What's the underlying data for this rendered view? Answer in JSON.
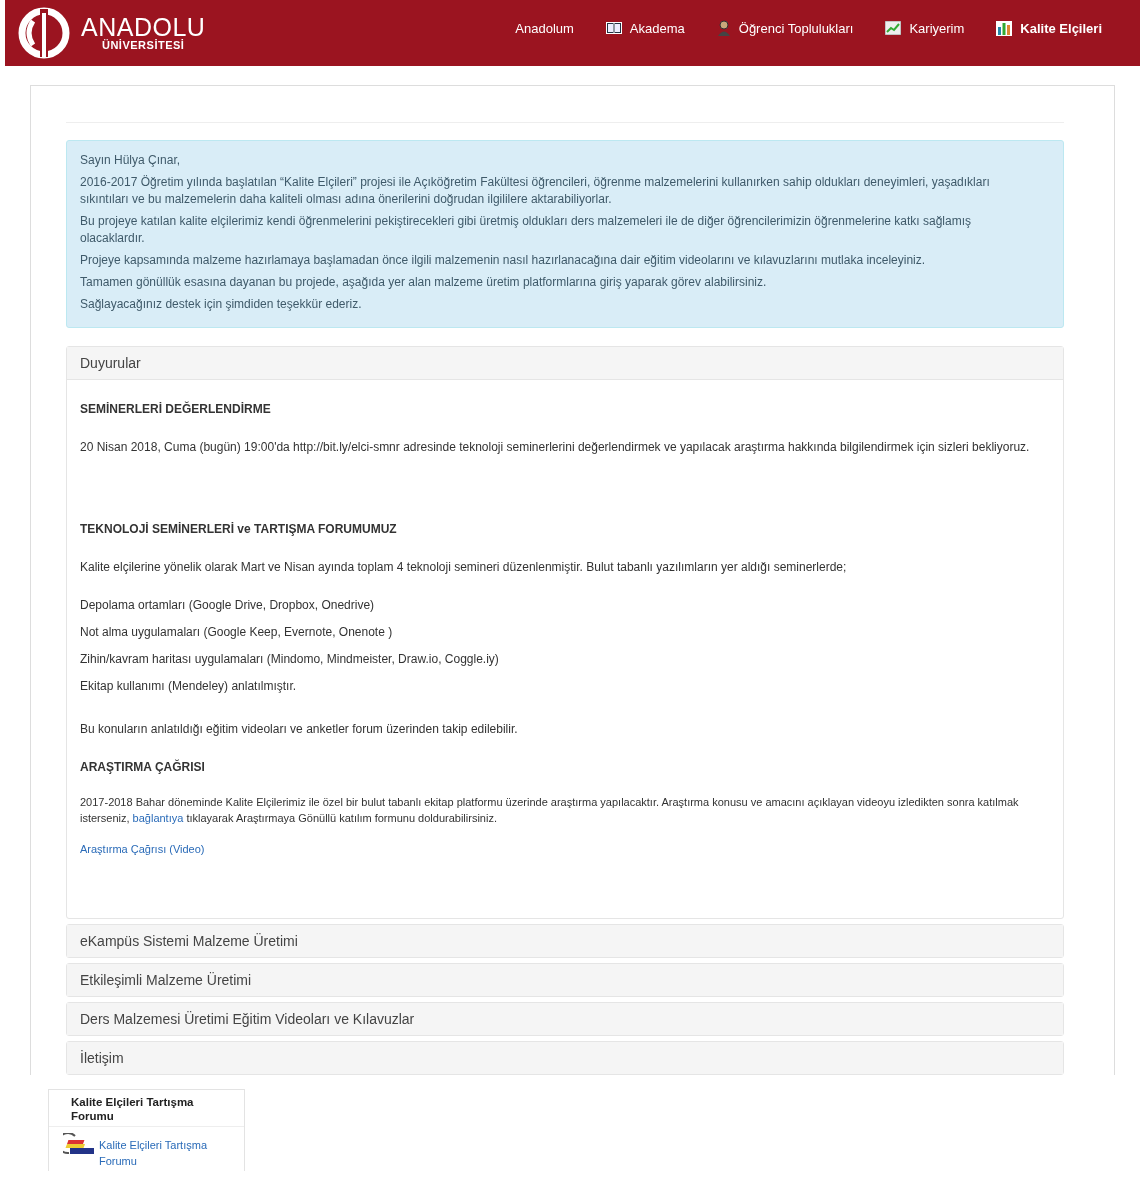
{
  "header": {
    "logo": {
      "name": "ANADOLU",
      "sub": "ÜNİVERSİTESİ"
    },
    "nav": [
      {
        "label": "Anadolum",
        "selected": false
      },
      {
        "label": "Akadema",
        "selected": false
      },
      {
        "label": "Öğrenci Toplulukları",
        "selected": false
      },
      {
        "label": "Kariyerim",
        "selected": false
      },
      {
        "label": "Kalite Elçileri",
        "selected": true
      }
    ]
  },
  "welcome": [
    "Sayın Hülya Çınar,",
    "2016-2017 Öğretim yılında başlatılan “Kalite Elçileri” projesi ile Açıköğretim Fakültesi öğrencileri, öğrenme malzemelerini kullanırken sahip oldukları deneyimleri, yaşadıkları sıkıntıları ve bu malzemelerin daha kaliteli olması adına önerilerini doğrudan ilgililere aktarabiliyorlar.",
    "Bu projeye katılan kalite elçilerimiz kendi öğrenmelerini pekiştirecekleri gibi üretmiş oldukları ders malzemeleri ile de diğer öğrencilerimizin öğrenmelerine katkı sağlamış olacaklardır.",
    "Projeye kapsamında malzeme hazırlamaya başlamadan önce ilgili malzemenin nasıl hazırlanacağına dair eğitim videolarını ve kılavuzlarını mutlaka inceleyiniz.",
    "Tamamen gönüllük esasına dayanan bu projede, aşağıda yer alan malzeme üretim platformlarına giriş yaparak görev alabilirsiniz.",
    "Sağlayacağınız destek için şimdiden teşekkür ederiz."
  ],
  "panels": [
    {
      "title": "Duyurular",
      "expanded": true,
      "blocks": [
        {
          "kind": "heading",
          "text": "SEMİNERLERİ DEĞERLENDİRME"
        },
        {
          "kind": "paragraph",
          "text": "20 Nisan 2018, Cuma (bugün) 19:00'da http://bit.ly/elci-smnr adresinde teknoloji seminerlerini değerlendirmek ve yapılacak araştırma hakkında bilgilendirmek için sizleri bekliyoruz."
        },
        {
          "kind": "heading",
          "text": "TEKNOLOJİ SEMİNERLERİ ve TARTIŞMA FORUMUMUZ"
        },
        {
          "kind": "paragraph",
          "text": "Kalite elçilerine yönelik olarak Mart ve Nisan ayında toplam 4 teknoloji semineri düzenlenmiştir. Bulut tabanlı yazılımların yer aldığı seminerlerde;"
        },
        {
          "kind": "item",
          "text": "Depolama ortamları (Google Drive, Dropbox, Onedrive)"
        },
        {
          "kind": "item",
          "text": "Not alma uygulamaları (Google Keep, Evernote, Onenote )"
        },
        {
          "kind": "item",
          "text": "Zihin/kavram haritası uygulamaları (Mindomo, Mindmeister, Draw.io, Coggle.iy)"
        },
        {
          "kind": "item",
          "text": "Ekitap kullanımı (Mendeley) anlatılmıştır."
        },
        {
          "kind": "paragraph",
          "text": "Bu konuların anlatıldığı eğitim videoları ve anketler forum üzerinden takip edilebilir."
        },
        {
          "kind": "subheading",
          "text": "ARAŞTIRMA ÇAĞRISI"
        },
        {
          "kind": "linked",
          "before": "2017-2018 Bahar döneminde Kalite Elçilerimiz ile özel bir bulut tabanlı ekitap platformu üzerinde araştırma yapılacaktır. Araştırma konusu ve amacını açıklayan videoyu izledikten sonra katılmak isterseniz, ",
          "link": "bağlantıya",
          "after": " tıklayarak Araştırmaya Gönüllü katılım formunu doldurabilirsiniz."
        },
        {
          "kind": "link",
          "text": "Araştırma Çağrısı (Video)"
        }
      ]
    },
    {
      "title": "eKampüs Sistemi Malzeme Üretimi",
      "expanded": false
    },
    {
      "title": "Etkileşimli Malzeme Üretimi",
      "expanded": false
    },
    {
      "title": "Ders Malzemesi Üretimi Eğitim Videoları ve Kılavuzlar",
      "expanded": false
    },
    {
      "title": "İletişim",
      "expanded": false
    }
  ],
  "side_block": {
    "title": "Kalite Elçileri Tartışma Forumu",
    "link": "Kalite Elçileri Tartışma Forumu"
  }
}
